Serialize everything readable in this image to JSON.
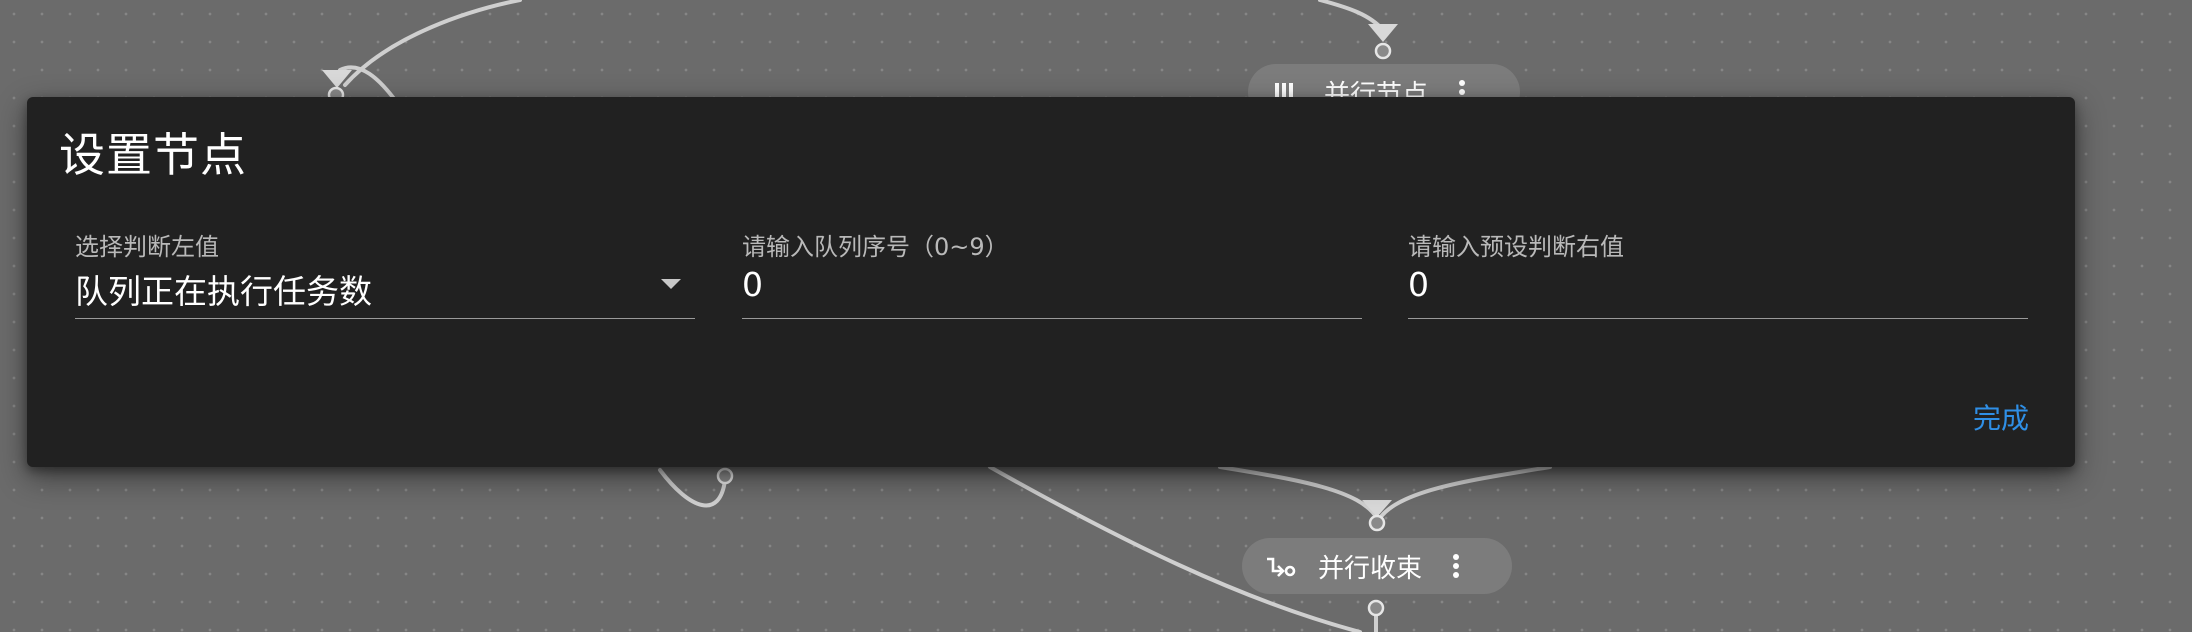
{
  "dialog": {
    "title": "设置节点",
    "fields": [
      {
        "label": "选择判断左值",
        "value": "队列正在执行任务数",
        "type": "select"
      },
      {
        "label": "请输入队列序号（0~9）",
        "value": "0",
        "type": "input"
      },
      {
        "label": "请输入预设判断右值",
        "value": "0",
        "type": "input"
      }
    ],
    "done_label": "完成",
    "accent_color": "#2f8fe6"
  },
  "background_nodes": [
    {
      "label": "并行节点",
      "icon": "parallel-icon",
      "partially_hidden": true
    },
    {
      "label": "并行收束",
      "icon": "merge-icon"
    }
  ],
  "colors": {
    "canvas": "#6b6b6b",
    "dialog": "#212121",
    "node": "#7c7c7c"
  }
}
